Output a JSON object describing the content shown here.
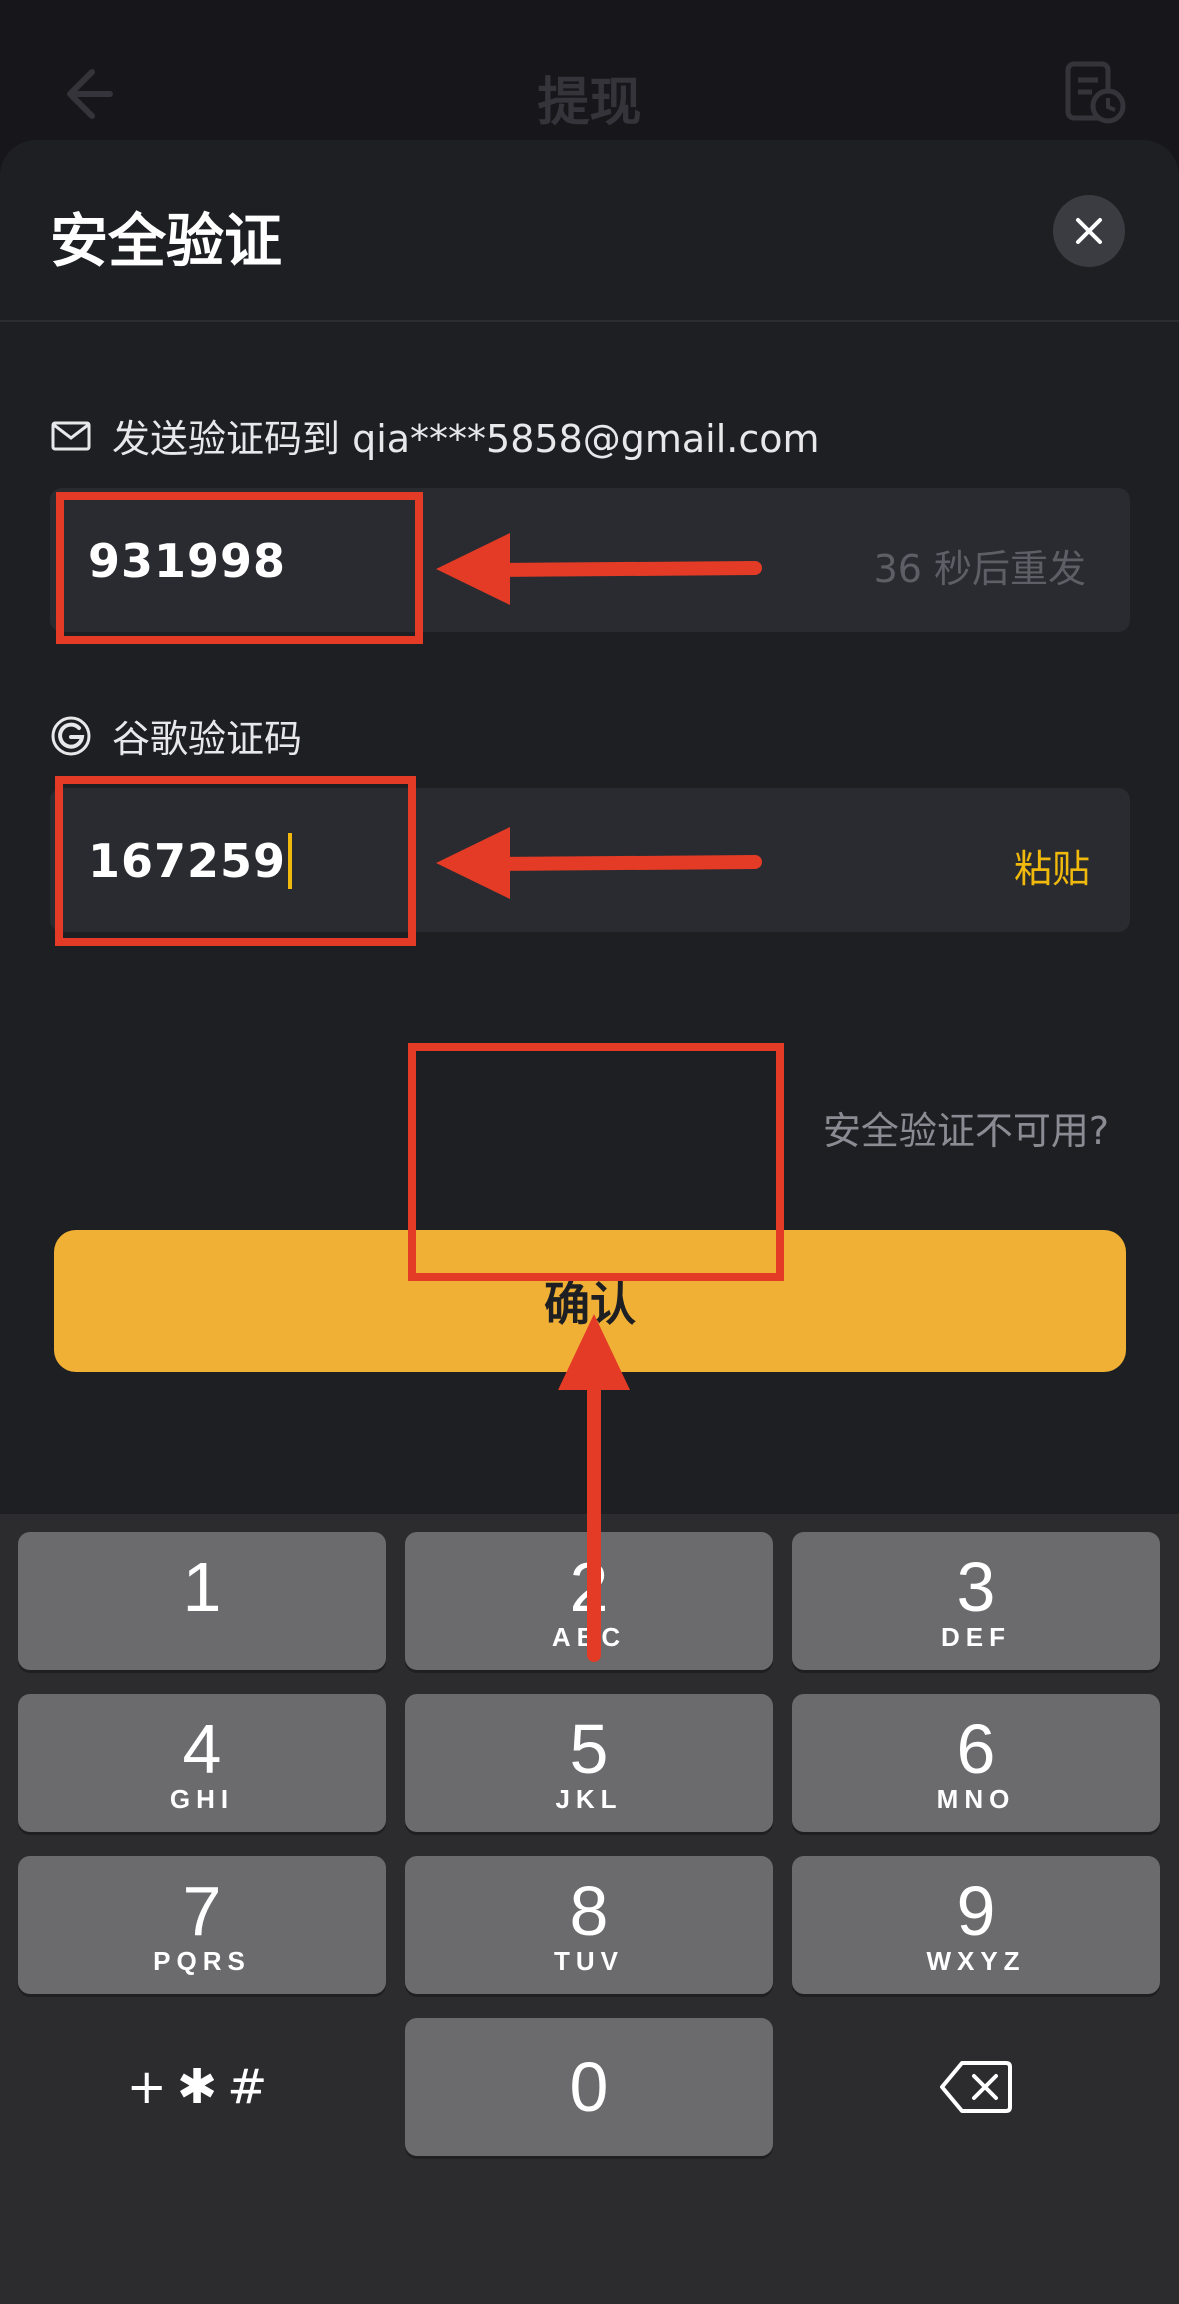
{
  "background_page": {
    "title": "提现"
  },
  "sheet": {
    "title": "安全验证",
    "email_section": {
      "label": "发送验证码到 qia****5858@gmail.com",
      "code_value": "931998",
      "resend_text": "36 秒后重发"
    },
    "google_section": {
      "label": "谷歌验证码",
      "code_value": "167259",
      "paste_label": "粘贴"
    },
    "unavailable_link": "安全验证不可用?",
    "confirm_label": "确认"
  },
  "keyboard": {
    "keys": [
      {
        "num": "1",
        "letters": ""
      },
      {
        "num": "2",
        "letters": "ABC"
      },
      {
        "num": "3",
        "letters": "DEF"
      },
      {
        "num": "4",
        "letters": "GHI"
      },
      {
        "num": "5",
        "letters": "JKL"
      },
      {
        "num": "6",
        "letters": "MNO"
      },
      {
        "num": "7",
        "letters": "PQRS"
      },
      {
        "num": "8",
        "letters": "TUV"
      },
      {
        "num": "9",
        "letters": "WXYZ"
      },
      {
        "num": "0",
        "letters": ""
      }
    ],
    "symbols_label": "+✱#"
  },
  "colors": {
    "accent": "#f0b035",
    "annotation_red": "#e33b26",
    "sheet_bg": "#1e1f23",
    "input_bg": "#2a2b30"
  }
}
